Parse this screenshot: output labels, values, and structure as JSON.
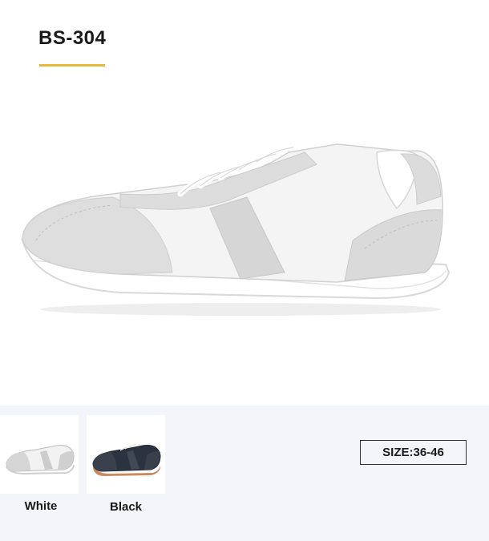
{
  "product": {
    "model": "BS-304"
  },
  "colors": {
    "accent": "#e7b93a",
    "suede": "#dcdcdc",
    "mesh": "#f7f7f7"
  },
  "variants": [
    {
      "label": "White",
      "icon": "white-sneaker-thumbnail"
    },
    {
      "label": "Black",
      "icon": "black-sneaker-thumbnail"
    }
  ],
  "size": {
    "label": "SIZE:36-46"
  }
}
